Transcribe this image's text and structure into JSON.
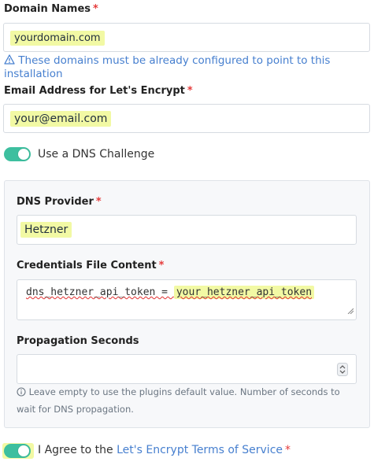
{
  "domain_names": {
    "label": "Domain Names",
    "required": "*",
    "value": "yourdomain.com",
    "hint": "These domains must be already configured to point to this installation"
  },
  "email": {
    "label": "Email Address for Let's Encrypt",
    "required": "*",
    "value": "your@email.com"
  },
  "dns_challenge": {
    "label": "Use a DNS Challenge",
    "enabled": true
  },
  "dns_provider": {
    "label": "DNS Provider",
    "required": "*",
    "value": "Hetzner"
  },
  "credentials": {
    "label": "Credentials File Content",
    "required": "*",
    "prefix": "dns_hetzner_api_token = ",
    "value": "your_hetzner_api_token"
  },
  "propagation": {
    "label": "Propagation Seconds",
    "value": "",
    "help": "Leave empty to use the plugins default value. Number of seconds to wait for DNS propagation."
  },
  "agree": {
    "text": "I Agree to the",
    "link": "Let's Encrypt Terms of Service",
    "required": "*",
    "enabled": true
  },
  "colors": {
    "accent": "#3dbf9f",
    "link": "#467fcf",
    "required": "#e53b3b",
    "highlight": "#f2f9a4"
  }
}
